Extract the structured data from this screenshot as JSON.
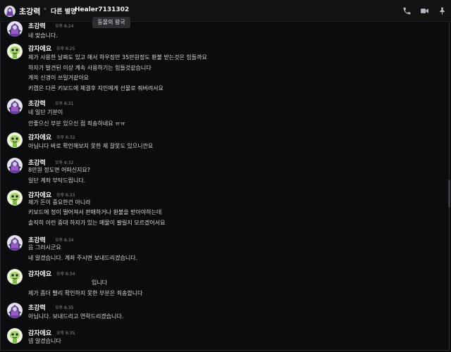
{
  "header": {
    "name": "초강력",
    "nickname": "다른 별명",
    "tag": "Healer7131302"
  },
  "tooltip": "동물의 왕국",
  "messages": [
    {
      "user": "초강력",
      "avatar": "robot",
      "time": "오후 6:24",
      "lines": [
        "네 맞습니다."
      ]
    },
    {
      "user": "감자에요",
      "avatar": "alien",
      "time": "오후 6:25",
      "lines": [
        "제가 사용한 날짜도 있고 해서 하우징만 35만원정도 환불 받는것은 힘들까요",
        "하자가 발견된 이상 계속 사용하기는 힘들것같습니다",
        "계쏙 신경이 쓰일거같아요",
        "키캡은 다른 키보드에 체결후 지인에게 선물로 줘버려서요"
      ]
    },
    {
      "user": "초강력",
      "avatar": "robot",
      "time": "오후 6:31",
      "lines": [
        "네 일단 기분이",
        "안좋으신 부분 있으신 점 죄송하네요 ㅠㅠ"
      ]
    },
    {
      "user": "감자에요",
      "avatar": "alien",
      "time": "오후 6:32",
      "lines": [
        "아닙니다 바로 확인해보지 못한 제 잘못도 있으니깐요"
      ]
    },
    {
      "user": "초강력",
      "avatar": "robot",
      "time": "오후 6:32",
      "lines": [
        "8만원 정도면 어떠신지요?",
        "일단 계좌 부탁드립니다."
      ]
    },
    {
      "user": "감자에요",
      "avatar": "alien",
      "time": "오후 6:33",
      "lines": [
        "제가 돈이 중요한건 아니라",
        "키보드에 정이 떨어져서 판매하거나 환불을 받아야하는데",
        "솔직히 이런 중대 하자가 있는 매물이 팔릴지 모르겠어서요"
      ]
    },
    {
      "user": "초강력",
      "avatar": "robot",
      "time": "오후 6:34",
      "lines": [
        "음 그러시군요",
        "네 알겠습니다. 계좌 주시면 보내드리겠습니다."
      ]
    },
    {
      "user": "감자에요",
      "avatar": "alien",
      "time": "오후 6:34",
      "lines": [
        "입니다",
        "제가 좀더 빨리 확인하지 못한 부분은 죄송합니다"
      ]
    },
    {
      "user": "초강력",
      "avatar": "robot",
      "time": "오후 6:35",
      "lines": [
        "아닙니다. 보내드리고 연락드리겠습니다."
      ]
    },
    {
      "user": "감자에요",
      "avatar": "alien",
      "time": "오후 6:35",
      "lines": [
        "넵 알겠습니다"
      ]
    }
  ]
}
